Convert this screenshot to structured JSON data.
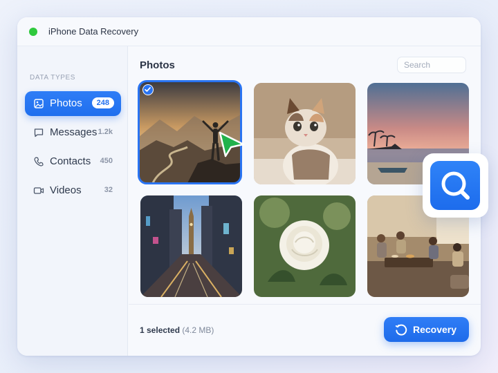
{
  "app": {
    "title": "iPhone Data Recovery"
  },
  "sidebar": {
    "heading": "DATA TYPES",
    "items": [
      {
        "label": "Photos",
        "count": "248",
        "icon": "image-icon",
        "active": true
      },
      {
        "label": "Messages",
        "count": "1.2k",
        "icon": "message-icon",
        "active": false
      },
      {
        "label": "Contacts",
        "count": "450",
        "icon": "phone-icon",
        "active": false
      },
      {
        "label": "Videos",
        "count": "32",
        "icon": "video-icon",
        "active": false
      }
    ]
  },
  "main": {
    "title": "Photos",
    "search_placeholder": "Search",
    "photos": [
      {
        "subject": "hiker-on-mountain",
        "selected": true
      },
      {
        "subject": "kitten",
        "selected": false
      },
      {
        "subject": "beach-sunset",
        "selected": false
      },
      {
        "subject": "city-street-big-ben",
        "selected": false
      },
      {
        "subject": "white-rose",
        "selected": false
      },
      {
        "subject": "family-living-room",
        "selected": false
      }
    ]
  },
  "footer": {
    "selected_text": "1 selected",
    "selected_size": "(4.2 MB)",
    "recover_label": "Recovery"
  },
  "colors": {
    "accent": "#2a74f2",
    "online_dot": "#2fc93d",
    "cursor": "#22b24c"
  }
}
